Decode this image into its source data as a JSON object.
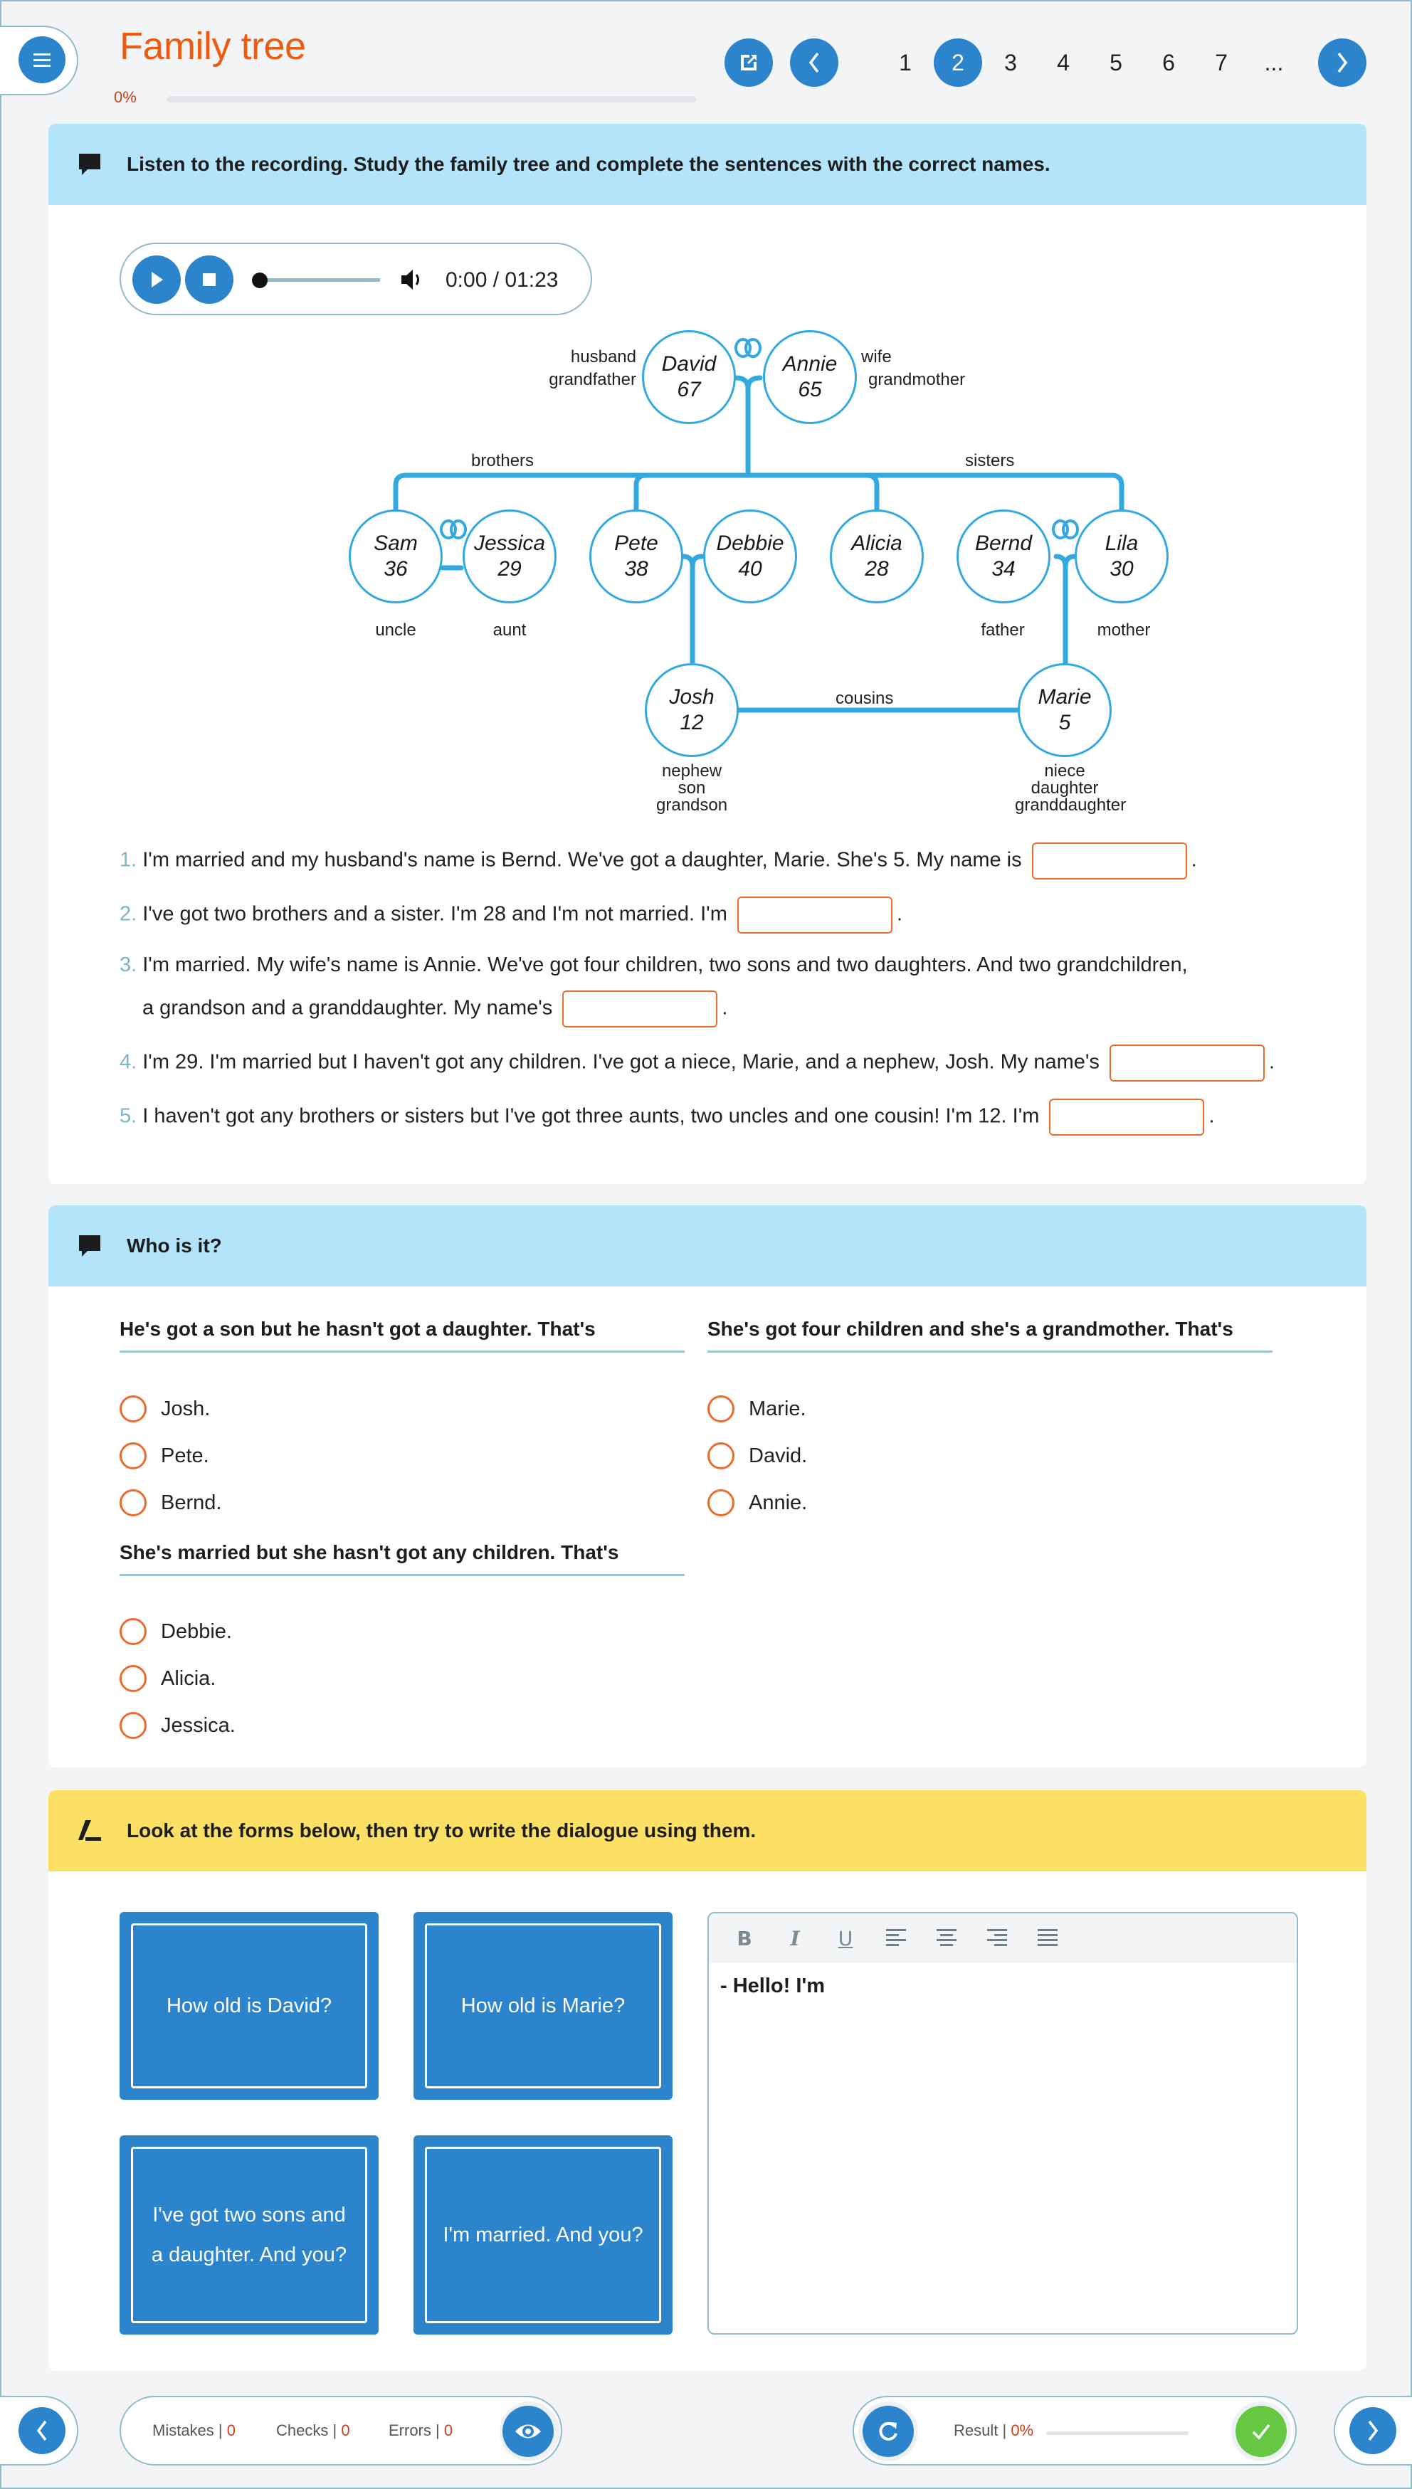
{
  "header": {
    "title": "Family tree",
    "progress_label": "0%",
    "progress_fraction": 0,
    "pages": [
      "1",
      "2",
      "3",
      "4",
      "5",
      "6",
      "7",
      "..."
    ],
    "current_page": "2"
  },
  "section1": {
    "instruction": "Listen to the recording. Study the family tree and complete the sentences with the correct names.",
    "audio": {
      "time": "0:00 / 01:23",
      "position_fraction": 0
    },
    "tree": {
      "people": [
        {
          "name": "David",
          "age": "67"
        },
        {
          "name": "Annie",
          "age": "65"
        },
        {
          "name": "Sam",
          "age": "36"
        },
        {
          "name": "Jessica",
          "age": "29"
        },
        {
          "name": "Pete",
          "age": "38"
        },
        {
          "name": "Debbie",
          "age": "40"
        },
        {
          "name": "Alicia",
          "age": "28"
        },
        {
          "name": "Bernd",
          "age": "34"
        },
        {
          "name": "Lila",
          "age": "30"
        },
        {
          "name": "Josh",
          "age": "12"
        },
        {
          "name": "Marie",
          "age": "5"
        }
      ],
      "labels": {
        "david": [
          "husband",
          "grandfather"
        ],
        "annie": [
          "wife",
          "grandmother"
        ],
        "brothers": "brothers",
        "sisters": "sisters",
        "sam": "uncle",
        "jessica": "aunt",
        "bernd": "father",
        "lila": "mother",
        "cousins": "cousins",
        "josh": [
          "nephew",
          "son",
          "grandson"
        ],
        "marie": [
          "niece",
          "daughter",
          "granddaughter"
        ]
      }
    },
    "sentences": [
      {
        "num": "1.",
        "before": "I'm married and my husband's name is Bernd. We've got a daughter, Marie. She's 5. My name is",
        "after": ".",
        "value": ""
      },
      {
        "num": "2.",
        "before": "I've got two brothers and a sister. I'm 28 and I'm not married. I'm",
        "after": ".",
        "value": ""
      },
      {
        "num": "3.",
        "before": "I'm married. My wife's name is Annie. We've got four children, two sons and two daughters. And two grandchildren,",
        "before2": "a grandson and a granddaughter. My name's",
        "after": ".",
        "value": ""
      },
      {
        "num": "4.",
        "before": "I'm 29. I'm married but I haven't got any children. I've got a niece, Marie, and a nephew, Josh. My name's",
        "after": ".",
        "value": ""
      },
      {
        "num": "5.",
        "before": "I haven't got any brothers or sisters but I've got three aunts, two uncles and one cousin! I'm 12. I'm",
        "after": ".",
        "value": ""
      }
    ]
  },
  "section2": {
    "instruction": "Who is it?",
    "questions": [
      {
        "prompt": "He's got a son but he hasn't got a daughter. That's",
        "options": [
          "Josh.",
          "Pete.",
          "Bernd."
        ]
      },
      {
        "prompt": "She's got four children and she's a grandmother. That's",
        "options": [
          "Marie.",
          "David.",
          "Annie."
        ]
      },
      {
        "prompt": "She's married but she hasn't got any children. That's",
        "options": [
          "Debbie.",
          "Alicia.",
          "Jessica."
        ]
      }
    ]
  },
  "section3": {
    "instruction": "Look at the forms below, then try to write the dialogue using them.",
    "cards": [
      "How old is David?",
      "How old is Marie?",
      "I've got two sons and a daughter. And you?",
      "I'm married. And you?"
    ],
    "toolbar": [
      "B",
      "I",
      "U",
      "align-left",
      "align-center",
      "align-right",
      "align-justify"
    ],
    "editor_text": "- Hello! I'm"
  },
  "footer": {
    "mistakes_label": "Mistakes |",
    "mistakes": "0",
    "checks_label": "Checks |",
    "checks": "0",
    "errors_label": "Errors |",
    "errors": "0",
    "result_label": "Result |",
    "result": "0%",
    "result_fraction": 0
  },
  "colors": {
    "accent": "#2b84cc",
    "title": "#f05a0f",
    "tree_line": "#33a9e0",
    "blank_border": "#ee6a2c",
    "check": "#66c742",
    "header_blue": "#b3e4fa",
    "header_yellow": "#fbe065"
  }
}
